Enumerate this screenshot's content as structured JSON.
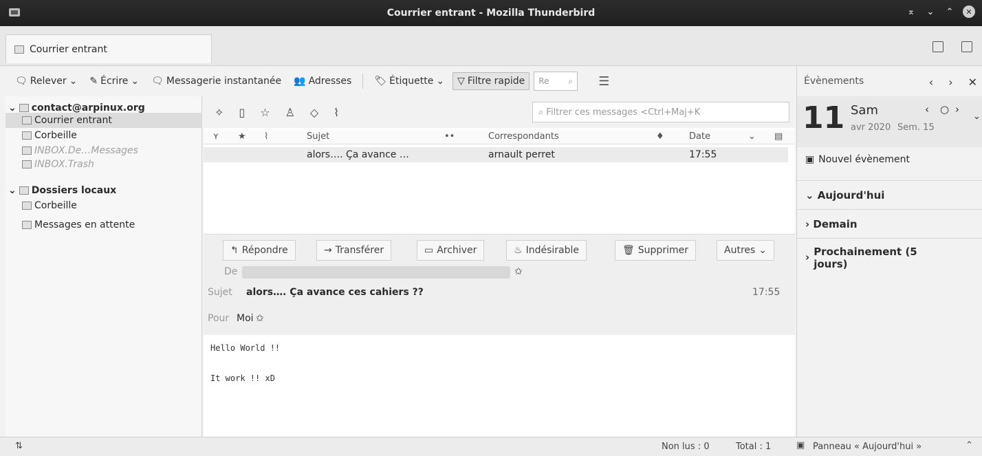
{
  "window": {
    "title": "Courrier entrant - Mozilla Thunderbird"
  },
  "tab": {
    "label": "Courrier entrant"
  },
  "toolbar": {
    "get_label": "Relever",
    "write_label": "Écrire",
    "chat_label": "Messagerie instantanée",
    "address_label": "Adresses",
    "tag_label": "Étiquette",
    "quickfilter_label": "Filtre rapide",
    "search_value": "Re"
  },
  "folders": {
    "account": "contact@arpinux.org",
    "inbox": "Courrier entrant",
    "trash": "Corbeille",
    "inbox_de": "INBOX.De…Messages",
    "inbox_trash": "INBOX.Trash",
    "local": "Dossiers locaux",
    "local_trash": "Corbeille",
    "outbox": "Messages en attente"
  },
  "quickfilter": {
    "placeholder": "Filtrer ces messages <Ctrl+Maj+K"
  },
  "columns": {
    "subject": "Sujet",
    "correspondents": "Correspondants",
    "date": "Date"
  },
  "messages": [
    {
      "subject": "alors…. Ça avance …",
      "correspondent": "arnault perret",
      "date": "17:55"
    }
  ],
  "reader": {
    "reply": "Répondre",
    "forward": "Transférer",
    "archive": "Archiver",
    "junk": "Indésirable",
    "delete": "Supprimer",
    "more": "Autres",
    "from_label": "De",
    "subject_label": "Sujet",
    "subject": "alors…. Ça avance ces cahiers ??",
    "time": "17:55",
    "to_label": "Pour",
    "to": "Moi",
    "body_line1": "Hello World !!",
    "body_line2": "It work !! xD"
  },
  "events": {
    "title": "Évènements",
    "day_num": "11",
    "day_name": "Sam",
    "month_year": "avr 2020",
    "week": "Sem. 15",
    "new_event": "Nouvel évènement",
    "today": "Aujourd'hui",
    "tomorrow": "Demain",
    "upcoming": "Prochainement (5 jours)"
  },
  "status": {
    "unread": "Non lus : 0",
    "total": "Total : 1",
    "today_pane": "Panneau « Aujourd'hui »"
  }
}
